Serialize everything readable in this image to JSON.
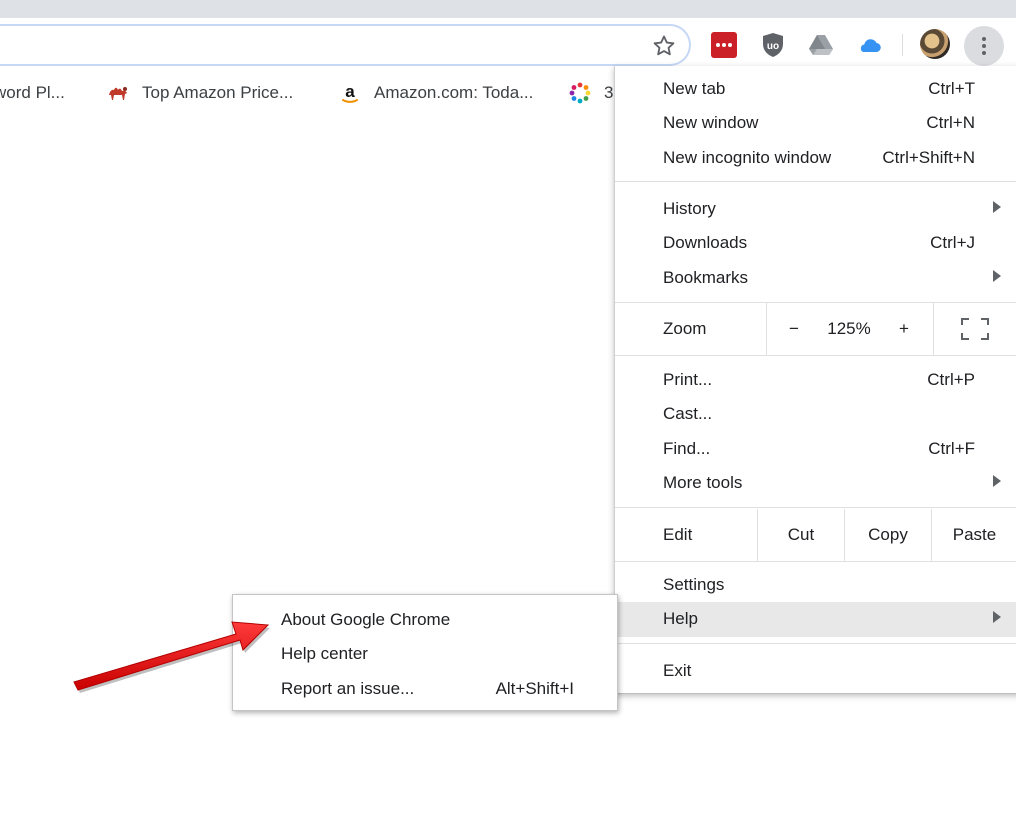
{
  "toolbar": {
    "bookmark_star": "star-icon",
    "extensions": [
      "lastpass-icon",
      "ublock-origin-icon",
      "google-drive-icon",
      "icloud-icon"
    ],
    "menu_button": "more-vert-icon",
    "colors": {
      "lastpass": "#cc2029",
      "icloud": "#3693f3",
      "omnibox_focus": "#c6d8f6"
    }
  },
  "bookmarks": [
    {
      "label": "word Pl...",
      "icon": "keyword-planner-icon"
    },
    {
      "label": "Top Amazon Price...",
      "icon": "camel-icon"
    },
    {
      "label": "Amazon.com: Toda...",
      "icon": "amazon-icon"
    },
    {
      "label": "3",
      "icon": "colorful-dots-icon"
    }
  ],
  "menu": {
    "new_tab": {
      "label": "New tab",
      "shortcut": "Ctrl+T"
    },
    "new_window": {
      "label": "New window",
      "shortcut": "Ctrl+N"
    },
    "new_incognito": {
      "label": "New incognito window",
      "shortcut": "Ctrl+Shift+N"
    },
    "history": {
      "label": "History"
    },
    "downloads": {
      "label": "Downloads",
      "shortcut": "Ctrl+J"
    },
    "bookmarks": {
      "label": "Bookmarks"
    },
    "zoom": {
      "label": "Zoom",
      "minus": "−",
      "level": "125%",
      "plus": "+"
    },
    "print": {
      "label": "Print...",
      "shortcut": "Ctrl+P"
    },
    "cast": {
      "label": "Cast..."
    },
    "find": {
      "label": "Find...",
      "shortcut": "Ctrl+F"
    },
    "more_tools": {
      "label": "More tools"
    },
    "edit": {
      "label": "Edit",
      "cut": "Cut",
      "copy": "Copy",
      "paste": "Paste"
    },
    "settings": {
      "label": "Settings"
    },
    "help": {
      "label": "Help"
    },
    "exit": {
      "label": "Exit"
    }
  },
  "help_submenu": {
    "about": {
      "label": "About Google Chrome"
    },
    "help_center": {
      "label": "Help center"
    },
    "report": {
      "label": "Report an issue...",
      "shortcut": "Alt+Shift+I"
    }
  },
  "annotation": {
    "color": "#e8141b"
  }
}
